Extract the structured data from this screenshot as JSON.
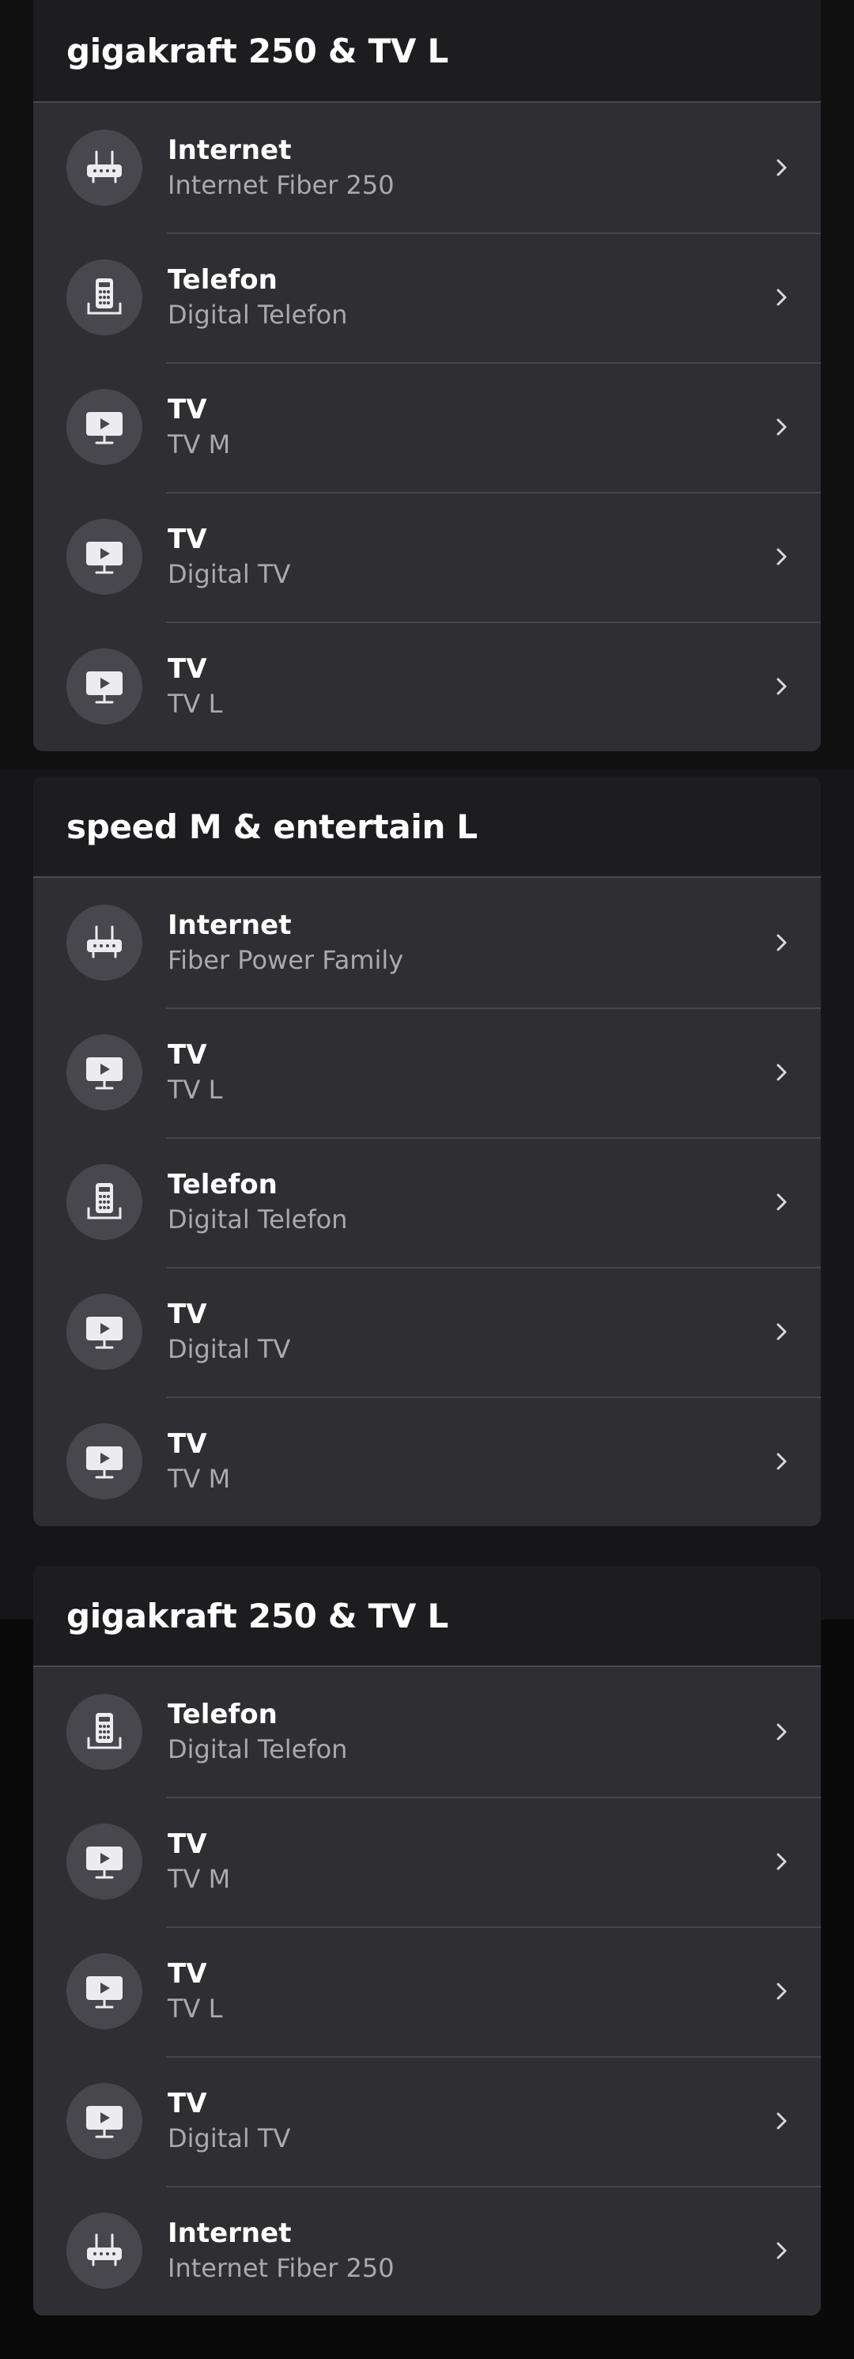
{
  "cards": [
    {
      "title": "gigakraft 250 & TV L",
      "items": [
        {
          "icon": "router-icon",
          "title": "Internet",
          "subtitle": "Internet Fiber 250"
        },
        {
          "icon": "phone-icon",
          "title": "Telefon",
          "subtitle": "Digital Telefon"
        },
        {
          "icon": "tv-icon",
          "title": "TV",
          "subtitle": "TV M"
        },
        {
          "icon": "tv-icon",
          "title": "TV",
          "subtitle": "Digital TV"
        },
        {
          "icon": "tv-icon",
          "title": "TV",
          "subtitle": "TV L"
        }
      ]
    },
    {
      "title": "speed M & entertain L",
      "items": [
        {
          "icon": "router-icon",
          "title": "Internet",
          "subtitle": "Fiber Power Family"
        },
        {
          "icon": "tv-icon",
          "title": "TV",
          "subtitle": "TV L"
        },
        {
          "icon": "phone-icon",
          "title": "Telefon",
          "subtitle": "Digital Telefon"
        },
        {
          "icon": "tv-icon",
          "title": "TV",
          "subtitle": "Digital TV"
        },
        {
          "icon": "tv-icon",
          "title": "TV",
          "subtitle": "TV M"
        }
      ]
    },
    {
      "title": "gigakraft 250 & TV L",
      "items": [
        {
          "icon": "phone-icon",
          "title": "Telefon",
          "subtitle": "Digital Telefon"
        },
        {
          "icon": "tv-icon",
          "title": "TV",
          "subtitle": "TV M"
        },
        {
          "icon": "tv-icon",
          "title": "TV",
          "subtitle": "TV L"
        },
        {
          "icon": "tv-icon",
          "title": "TV",
          "subtitle": "Digital TV"
        },
        {
          "icon": "router-icon",
          "title": "Internet",
          "subtitle": "Internet Fiber 250"
        }
      ]
    }
  ],
  "chevron_icon": "chevron-right-icon"
}
